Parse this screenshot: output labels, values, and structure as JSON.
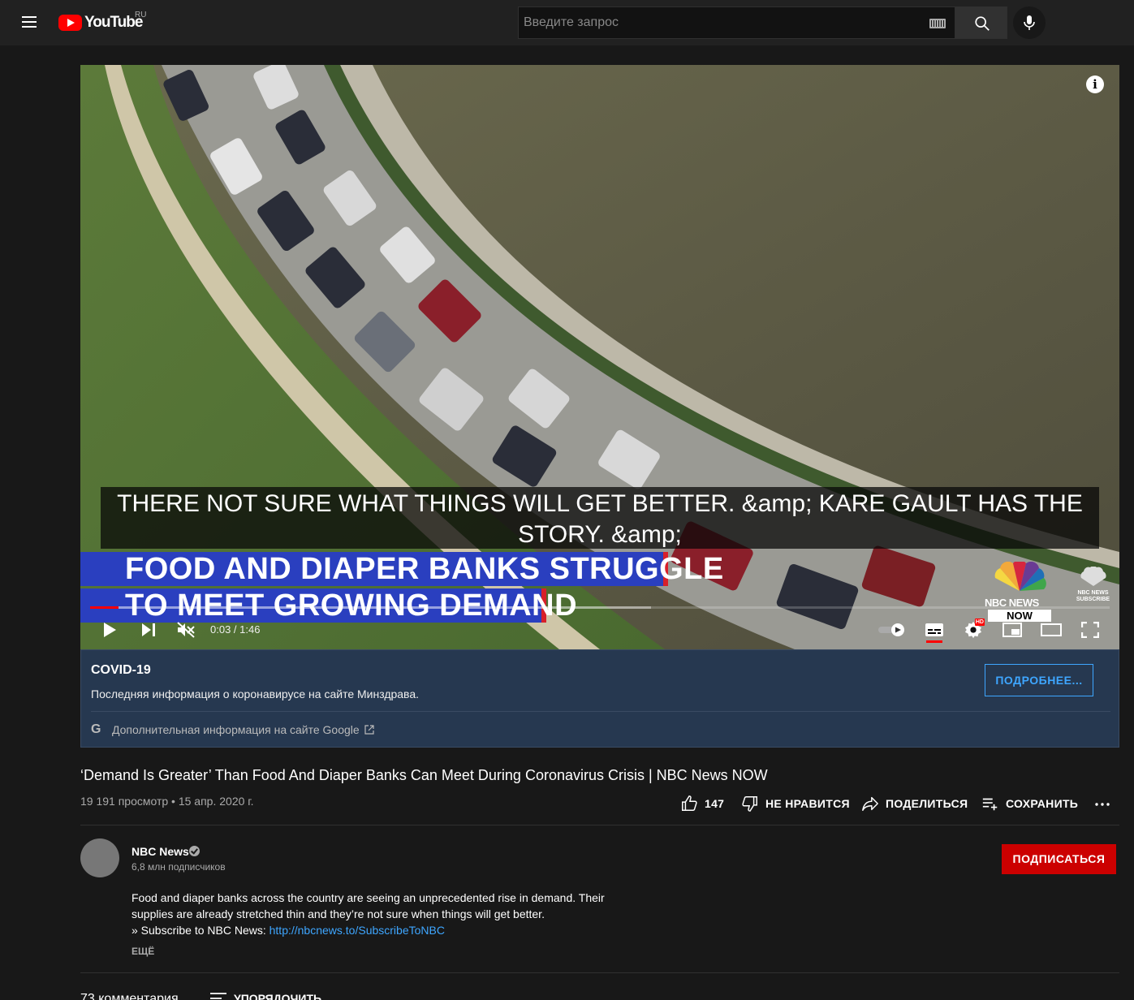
{
  "header": {
    "logo_text": "YouTube",
    "region": "RU",
    "search_placeholder": "Введите запрос"
  },
  "player": {
    "caption": "THERE NOT SURE WHAT THINGS WILL GET BETTER. &amp; KARE GAULT HAS THE STORY. &amp;",
    "chyron_line1": "FOOD AND DIAPER BANKS STRUGGLE",
    "chyron_line2": "TO MEET GROWING DEMAND",
    "watermark_text": "NBC NEWS",
    "watermark_now": "NOW",
    "subscribe_watermark": "NBC NEWS SUBSCRIBE",
    "time": "0:03 / 1:46",
    "played_fraction": 0.028,
    "buffered_fraction": 0.55
  },
  "covid": {
    "title": "COVID-19",
    "text": "Последняя информация о коронавирусе на сайте Минздрава.",
    "more_label": "ПОДРОБНЕЕ...",
    "google_text": "Дополнительная информация на сайте Google"
  },
  "video": {
    "title": "‘Demand Is Greater’ Than Food And Diaper Banks Can Meet During Coronavirus Crisis | NBC News NOW",
    "meta": "19 191 просмотр • 15 апр. 2020 г.",
    "likes": "147",
    "dislike_label": "НЕ НРАВИТСЯ",
    "share_label": "ПОДЕЛИТЬСЯ",
    "save_label": "СОХРАНИТЬ"
  },
  "channel": {
    "name": "NBC News",
    "subscribers": "6,8 млн подписчиков",
    "subscribe_label": "ПОДПИСАТЬСЯ",
    "desc_line1": "Food and diaper banks across the country are seeing an unprecedented rise in demand. Their supplies are already stretched thin and they’re not sure when things will get better.",
    "desc_prefix": "» Subscribe to NBC News: ",
    "desc_link": "http://nbcnews.to/SubscribeToNBC",
    "show_more": "ЕЩЁ"
  },
  "comments": {
    "count": "73 комментария",
    "sort_label": "УПОРЯДОЧИТЬ"
  }
}
